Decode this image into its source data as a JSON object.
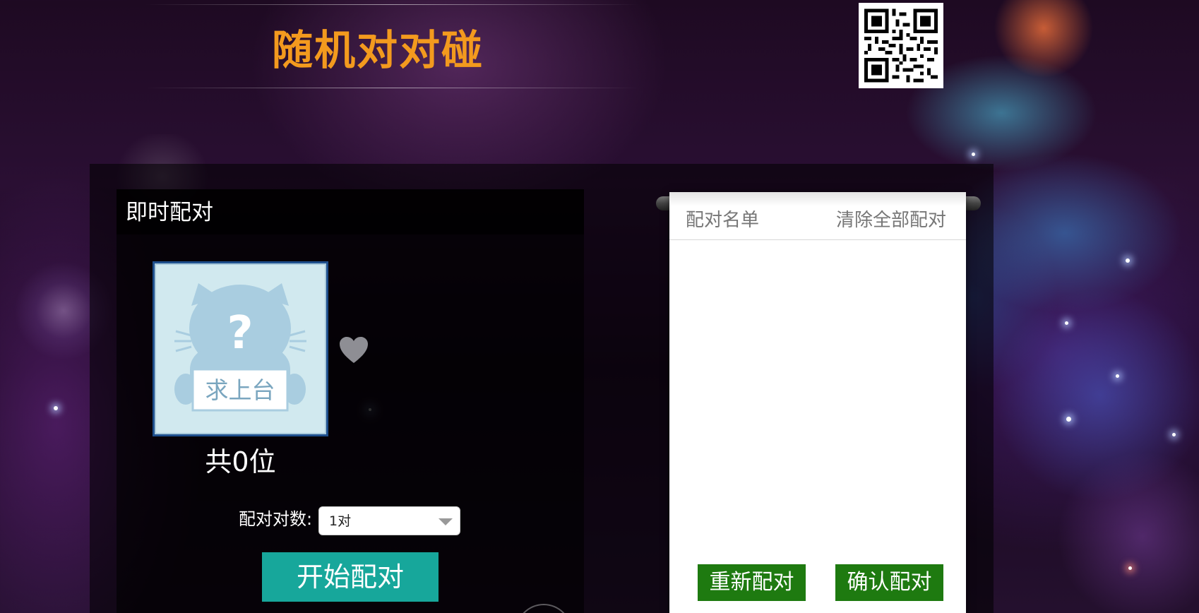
{
  "header": {
    "title": "随机对对碰"
  },
  "qr_code": {
    "icon": "qr-code-icon"
  },
  "instant_pairing": {
    "section_title": "即时配对",
    "avatar": {
      "sign_text": "求上台",
      "icon": "cat-placeholder-icon"
    },
    "heart_icon": "heart-icon",
    "count_text": "共0位",
    "pair_count_label": "配对对数:",
    "pair_count_selected": "1对",
    "start_button": "开始配对"
  },
  "pair_list_panel": {
    "title": "配对名单",
    "clear_all": "清除全部配对",
    "items": [],
    "repair_button": "重新配对",
    "confirm_button": "确认配对"
  },
  "colors": {
    "title": "#f39a1e",
    "start_button": "#17a79b",
    "green_button": "#1e7a10",
    "avatar_border": "#1e4f8c"
  }
}
